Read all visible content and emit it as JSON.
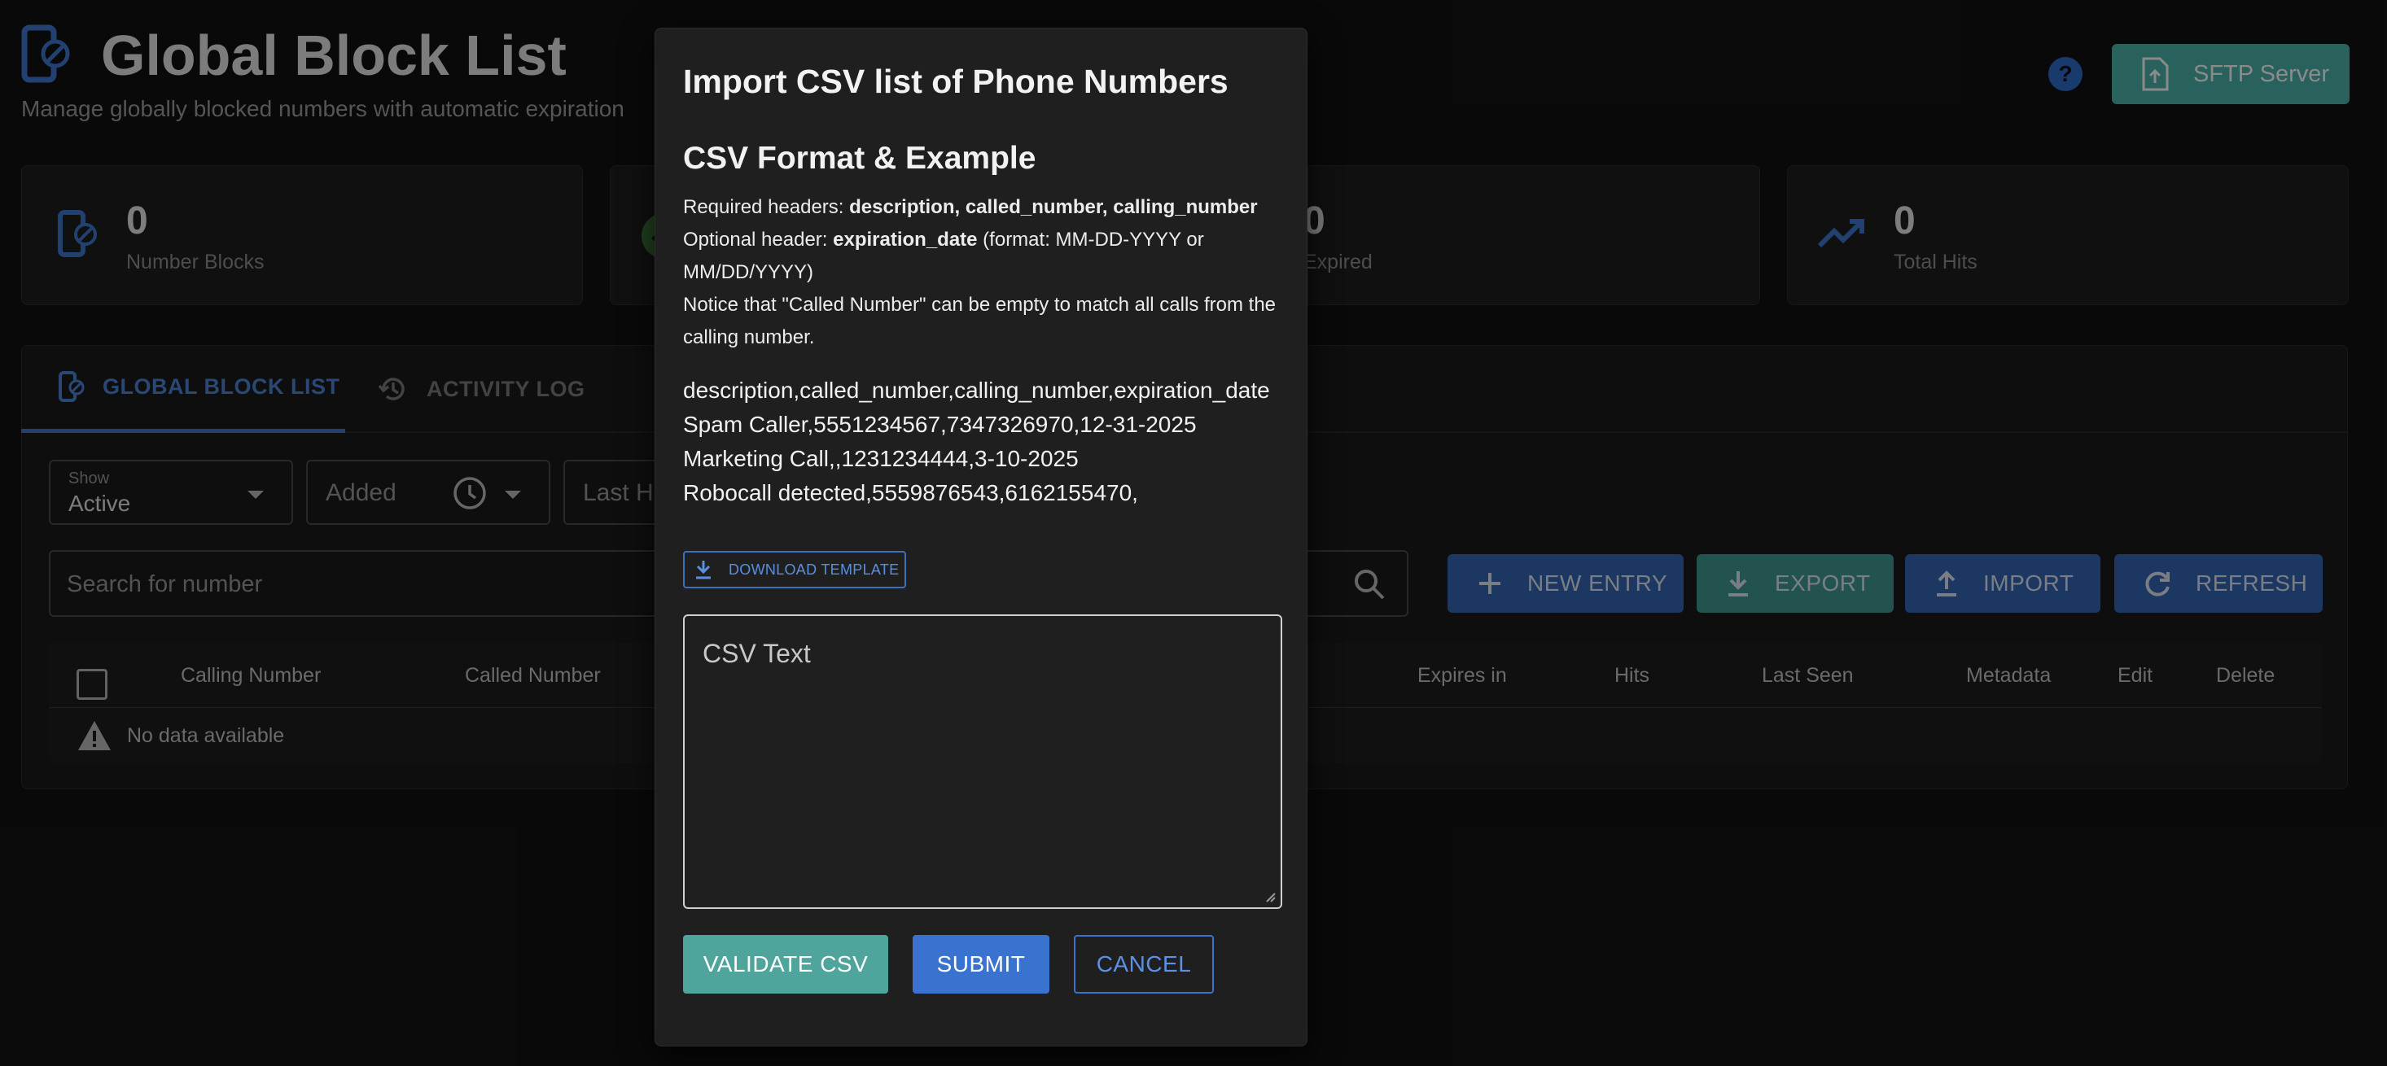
{
  "header": {
    "title": "Global Block List",
    "subtitle": "Manage globally blocked numbers with automatic expiration",
    "sftp_label": "SFTP Server"
  },
  "stats": [
    {
      "value": "0",
      "label": "Number Blocks",
      "icon": "phone-block-icon"
    },
    {
      "value": "",
      "label": "",
      "icon": "check-circle-icon"
    },
    {
      "value": "0",
      "label": "Expired",
      "icon": "expired-icon"
    },
    {
      "value": "0",
      "label": "Total Hits",
      "icon": "trending-up-icon"
    }
  ],
  "tabs": [
    {
      "label": "GLOBAL BLOCK LIST",
      "active": true
    },
    {
      "label": "ACTIVITY LOG",
      "active": false
    }
  ],
  "filters": {
    "show_label": "Show",
    "show_value": "Active",
    "added_placeholder": "Added",
    "last_hit_placeholder": "Last Hit"
  },
  "search": {
    "placeholder": "Search for number"
  },
  "actions": {
    "new_entry": "NEW ENTRY",
    "export": "EXPORT",
    "import": "IMPORT",
    "refresh": "REFRESH"
  },
  "table": {
    "columns": [
      "Calling Number",
      "Called Number",
      "Expires in",
      "Hits",
      "Last Seen",
      "Metadata",
      "Edit",
      "Delete"
    ],
    "empty_text": "No data available"
  },
  "dialog": {
    "title": "Import CSV list of Phone Numbers",
    "subtitle": "CSV Format & Example",
    "required_prefix": "Required headers: ",
    "required_headers": "description, called_number, calling_number",
    "optional_prefix": "Optional header: ",
    "optional_header": "expiration_date",
    "optional_suffix": " (format: MM-DD-YYYY or MM/DD/YYYY)",
    "notice": "Notice that \"Called Number\" can be empty to match all calls from the calling number.",
    "example_lines": [
      "description,called_number,calling_number,expiration_date",
      "Spam Caller,5551234567,7347326970,12-31-2025",
      "Marketing Call,,1231234444,3-10-2025",
      "Robocall detected,5559876543,6162155470,"
    ],
    "download_label": "DOWNLOAD TEMPLATE",
    "csv_placeholder": "CSV Text",
    "validate_label": "VALIDATE CSV",
    "submit_label": "SUBMIT",
    "cancel_label": "CANCEL"
  },
  "colors": {
    "accent_blue": "#3266b5",
    "accent_teal": "#3f9a92",
    "background": "#121212"
  }
}
